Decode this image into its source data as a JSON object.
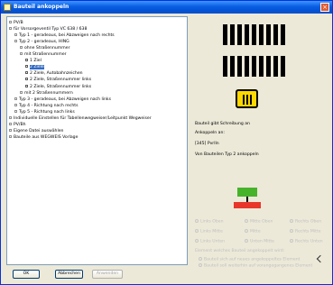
{
  "window": {
    "title": "Bauteil ankoppeln",
    "close_glyph": "×"
  },
  "tree": {
    "items": [
      {
        "label": "PV/B",
        "indent": 0,
        "sel": false
      },
      {
        "label": "für Vorsorgeventil Typ VC 638 / 638",
        "indent": 0,
        "sel": false
      },
      {
        "label": "Typ 1 - geradeaus, bei Abzweigen nach rechts",
        "indent": 1,
        "sel": false
      },
      {
        "label": "Typ 2 - geradeaus, HING",
        "indent": 1,
        "sel": false
      },
      {
        "label": "ohne Straßennummer",
        "indent": 2,
        "sel": false
      },
      {
        "label": "mit Straßennummer",
        "indent": 2,
        "sel": false
      },
      {
        "label": "1 Ziel",
        "indent": 3,
        "sel": false
      },
      {
        "label": "2 Ziele",
        "indent": 3,
        "sel": true
      },
      {
        "label": "2 Ziele, Autobahnzeichen",
        "indent": 3,
        "sel": false
      },
      {
        "label": "2 Ziele, Straßennummer links",
        "indent": 3,
        "sel": false
      },
      {
        "label": "2 Ziele, Straßennummer links",
        "indent": 3,
        "sel": false
      },
      {
        "label": "mit 2 Straßennummern",
        "indent": 2,
        "sel": false
      },
      {
        "label": "Typ 3 - geradeaus, bei Abzweigen nach links",
        "indent": 1,
        "sel": false
      },
      {
        "label": "Typ 4 - Richtung nach rechts",
        "indent": 1,
        "sel": false
      },
      {
        "label": "Typ 5 - Richtung nach links",
        "indent": 1,
        "sel": false
      },
      {
        "label": "Individuelle Einstellen für Tabellenwegweiser/Leitpunkt Wegweiser",
        "indent": 0,
        "sel": false
      },
      {
        "label": "PV/Bh",
        "indent": 0,
        "sel": false
      },
      {
        "label": "Eigene Datei auswählen",
        "indent": 0,
        "sel": false
      },
      {
        "label": "Bauteile aus WEGWEIS Vorlage",
        "indent": 0,
        "sel": false
      }
    ]
  },
  "panel": {
    "status_text": "Bauteil gibt Schreibung an",
    "info_label": "Ankoppeln an:",
    "info_value1": "[345] Pvrlln",
    "info_value2": "Von Bauteilen Typ 2 ankoppeln",
    "radio_row1": [
      "Links Oben",
      "Mitte Oben",
      "Rechts Oben"
    ],
    "radio_row2": [
      "Links Mitte",
      "Mitte",
      "Rechts Mitte"
    ],
    "radio_row3": [
      "Links Unten",
      "Unten Mitte",
      "Rechts Unten"
    ],
    "attach_label": "Element welches Bauteil angekoppelt wird:",
    "attach_opt1": "Bauteil sich auf neues angekoppeltes Element",
    "attach_opt2": "Bauteil soll weiterhin auf vorangegangenes Element"
  },
  "buttons": {
    "ok": "OK",
    "cancel": "Abbrechen",
    "apply": "Anwenden"
  },
  "colors": {
    "title_bar": "#0a5de2",
    "selection": "#316ac5",
    "sign_yellow": "#ffd700",
    "sign_green": "#46b32a",
    "sign_red": "#e8362a"
  }
}
